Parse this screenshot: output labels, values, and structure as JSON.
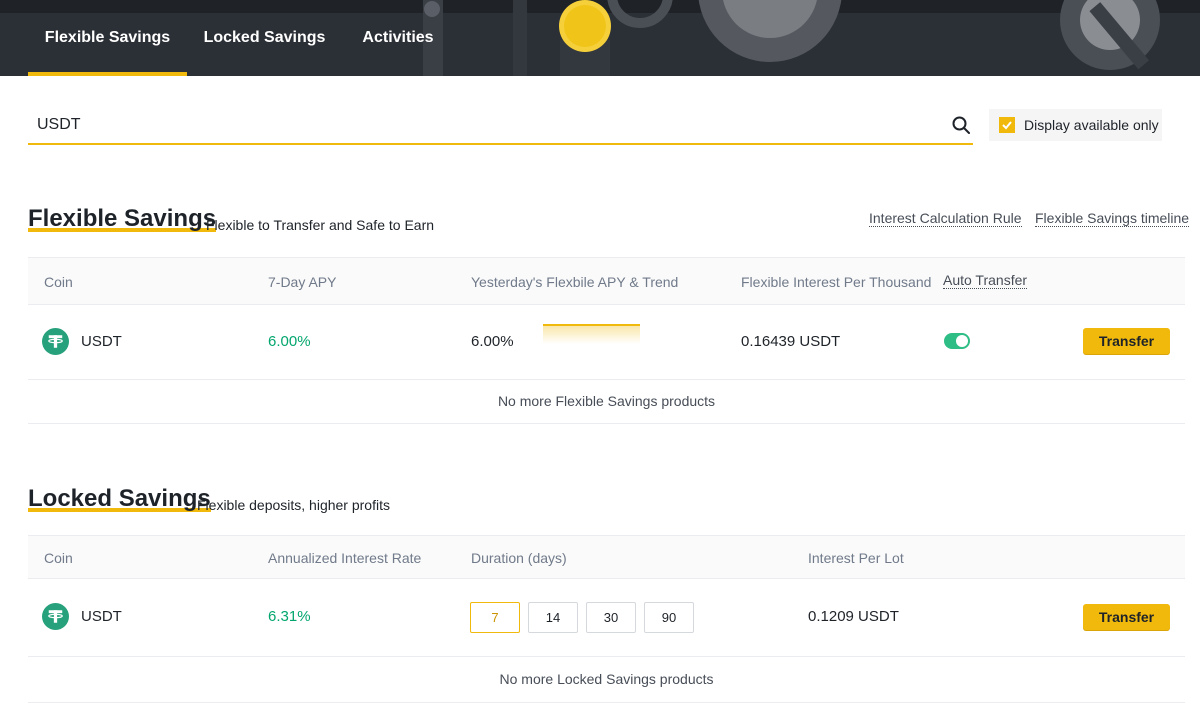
{
  "tabs": [
    {
      "label": "Flexible Savings",
      "active": true
    },
    {
      "label": "Locked Savings",
      "active": false
    },
    {
      "label": "Activities",
      "active": false
    }
  ],
  "search": {
    "value": "USDT",
    "placeholder": ""
  },
  "display_available_only": {
    "label": "Display available only",
    "checked": true
  },
  "flexible": {
    "title": "Flexible Savings",
    "subtitle": "Flexible to Transfer and Safe to Earn",
    "links": {
      "interest_rule": "Interest Calculation Rule",
      "timeline": "Flexible Savings timeline"
    },
    "headers": {
      "coin": "Coin",
      "apy7": "7-Day APY",
      "yesterday": "Yesterday's Flexbile APY & Trend",
      "interest_per_thousand": "Flexible Interest Per Thousand",
      "auto_transfer": "Auto Transfer"
    },
    "rows": [
      {
        "coin": "USDT",
        "coin_icon": "tether-icon",
        "apy7": "6.00%",
        "yesterday_apy": "6.00%",
        "trend": "flat",
        "interest_per_thousand": "0.16439 USDT",
        "auto_transfer": true,
        "action": "Transfer"
      }
    ],
    "footer": "No more Flexible Savings products"
  },
  "locked": {
    "title": "Locked Savings",
    "subtitle": "Flexible deposits, higher profits",
    "headers": {
      "coin": "Coin",
      "rate": "Annualized Interest Rate",
      "duration": "Duration (days)",
      "interest_per_lot": "Interest Per Lot"
    },
    "rows": [
      {
        "coin": "USDT",
        "coin_icon": "tether-icon",
        "rate": "6.31%",
        "durations": [
          "7",
          "14",
          "30",
          "90"
        ],
        "selected_duration": "7",
        "interest_per_lot": "0.1209 USDT",
        "action": "Transfer"
      }
    ],
    "footer": "No more Locked Savings products"
  },
  "colors": {
    "accent": "#f0b90b",
    "positive": "#03a66d",
    "banner": "#2b2f36",
    "toggle_on": "#2ebd85"
  }
}
